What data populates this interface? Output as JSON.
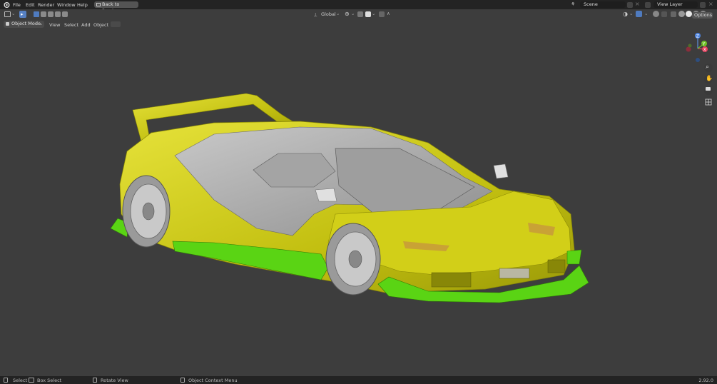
{
  "menus": [
    "File",
    "Edit",
    "Render",
    "Window",
    "Help"
  ],
  "back_to_previous": "Back to Previous",
  "scene": "Scene",
  "view_layer": "View Layer",
  "mode": "Object Mode",
  "view_menus": [
    "View",
    "Select",
    "Add",
    "Object"
  ],
  "transform_orientation": "Global",
  "options": "Options",
  "gizmo_axes": [
    "Z",
    "X",
    "Y"
  ],
  "status": {
    "select": "Select",
    "box_select": "Box Select",
    "rotate_view": "Rotate View",
    "context_menu": "Object Context Menu",
    "version": "2.92.0"
  },
  "colors": {
    "selected_yellow": "#c8c40c",
    "active_green": "#5ad414",
    "base_gray": "#a8a8a8"
  }
}
